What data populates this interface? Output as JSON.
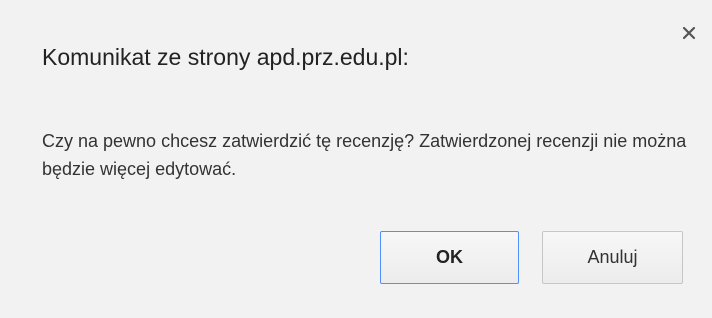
{
  "dialog": {
    "title": "Komunikat ze strony apd.prz.edu.pl:",
    "close_icon": "close-icon",
    "message": "Czy na pewno chcesz zatwierdzić tę recenzję? Zatwierdzonej recenzji nie można będzie więcej edytować.",
    "buttons": {
      "ok_label": "OK",
      "cancel_label": "Anuluj"
    },
    "colors": {
      "background": "#f2f2f2",
      "focus_border": "#4d90fe"
    }
  }
}
